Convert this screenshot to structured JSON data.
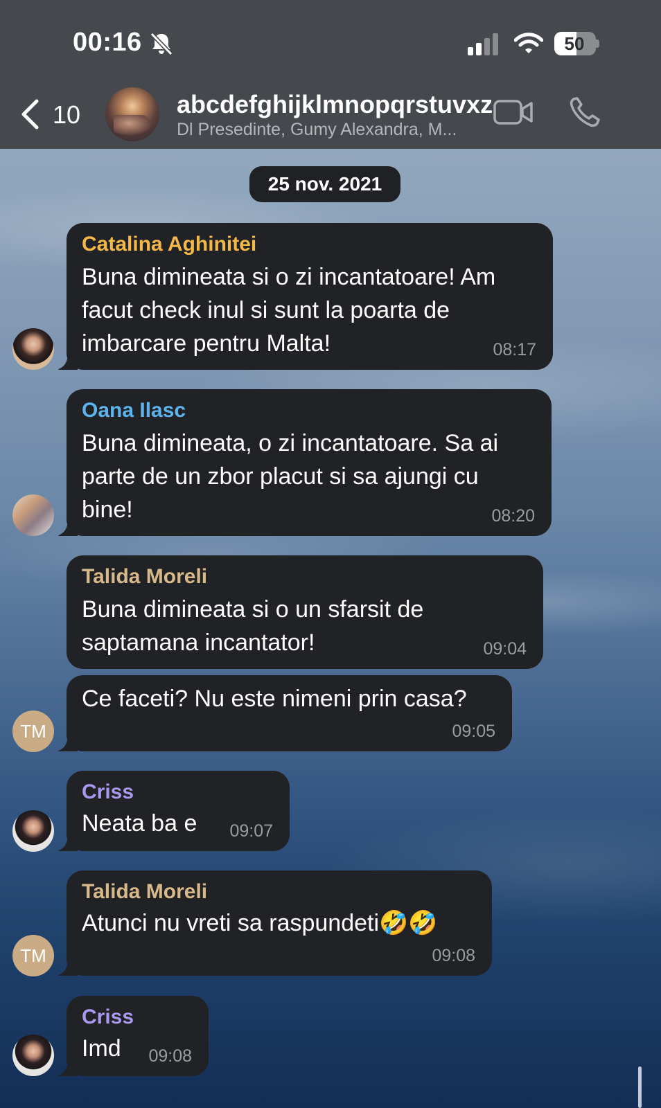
{
  "status_bar": {
    "time": "00:16",
    "battery": "50",
    "icons": [
      "bell-slash-icon",
      "signal-icon",
      "wifi-icon",
      "battery-icon"
    ]
  },
  "header": {
    "back_count": "10",
    "title": "abcdefghijklmnopqrstuvxz",
    "subtitle": "Dl Presedinte, Gumy Alexandra, M...",
    "icons": [
      "chevron-left-icon",
      "video-call-icon",
      "phone-icon"
    ]
  },
  "date_separator": "25 nov. 2021",
  "colors": {
    "header_bg": "#45484c",
    "bubble_bg": "#212225",
    "sender_catalina": "#f4b847",
    "sender_oana": "#5cb4ec",
    "sender_talida": "#d8b98c",
    "sender_criss": "#a99af0",
    "initials_avatar_bg": "#c9ac86"
  },
  "messages": [
    {
      "sender": "Catalina Aghinitei",
      "text": "Buna dimineata si o zi incantatoare! Am\nfacut check inul si sunt la poarta de\nimbarcare pentru Malta!",
      "time": "08:17"
    },
    {
      "sender": "Oana Ilasc",
      "text": "Buna dimineata, o zi incantatoare. Sa ai\nparte de un zbor placut si sa ajungi cu\nbine!",
      "time": "08:20"
    },
    {
      "sender": "Talida Moreli",
      "text": "Buna dimineata si o un sfarsit de\nsaptamana incantator!",
      "time": "09:04"
    },
    {
      "sender": "",
      "text": "Ce faceti? Nu este nimeni prin casa?",
      "time": "09:05",
      "avatar_initials": "TM"
    },
    {
      "sender": "Criss",
      "text": "Neata ba e",
      "time": "09:07"
    },
    {
      "sender": "Talida Moreli",
      "text": "Atunci nu vreti sa raspundeti🤣🤣",
      "time": "09:08",
      "avatar_initials": "TM"
    },
    {
      "sender": "Criss",
      "text": "Imd",
      "time": "09:08"
    }
  ]
}
